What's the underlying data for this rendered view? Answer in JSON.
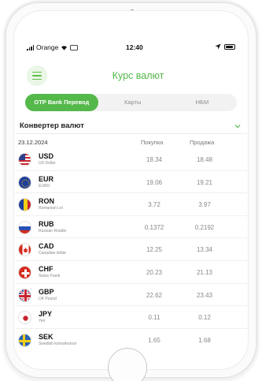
{
  "status": {
    "carrier": "Orange",
    "time": "12:40"
  },
  "header": {
    "title": "Курс валют"
  },
  "tabs": [
    {
      "label": "OTP Bank Перевод",
      "active": true
    },
    {
      "label": "Карты",
      "active": false
    },
    {
      "label": "НБМ",
      "active": false
    }
  ],
  "converter": {
    "label": "Конвертер валют"
  },
  "table": {
    "date": "23.12.2024",
    "buy_header": "Покупка",
    "sell_header": "Продажа",
    "rows": [
      {
        "code": "USD",
        "name": "US Dollar",
        "buy": "18.34",
        "sell": "18.48"
      },
      {
        "code": "EUR",
        "name": "EURO",
        "buy": "19.06",
        "sell": "19.21"
      },
      {
        "code": "RON",
        "name": "Romanian Lei",
        "buy": "3.72",
        "sell": "3.97"
      },
      {
        "code": "RUB",
        "name": "Russian Rouble",
        "buy": "0.1372",
        "sell": "0.2192"
      },
      {
        "code": "CAD",
        "name": "Canadian dollar",
        "buy": "12.25",
        "sell": "13.34"
      },
      {
        "code": "CHF",
        "name": "Swiss Frank",
        "buy": "20.23",
        "sell": "21.13"
      },
      {
        "code": "GBP",
        "name": "UK Pound",
        "buy": "22.62",
        "sell": "23.43"
      },
      {
        "code": "JPY",
        "name": "Yen",
        "buy": "0.11",
        "sell": "0.12"
      },
      {
        "code": "SEK",
        "name": "Swedish krona/kronor",
        "buy": "1.65",
        "sell": "1.68"
      }
    ]
  },
  "colors": {
    "accent": "#54b84a",
    "accent_light": "#eaf6e6"
  }
}
